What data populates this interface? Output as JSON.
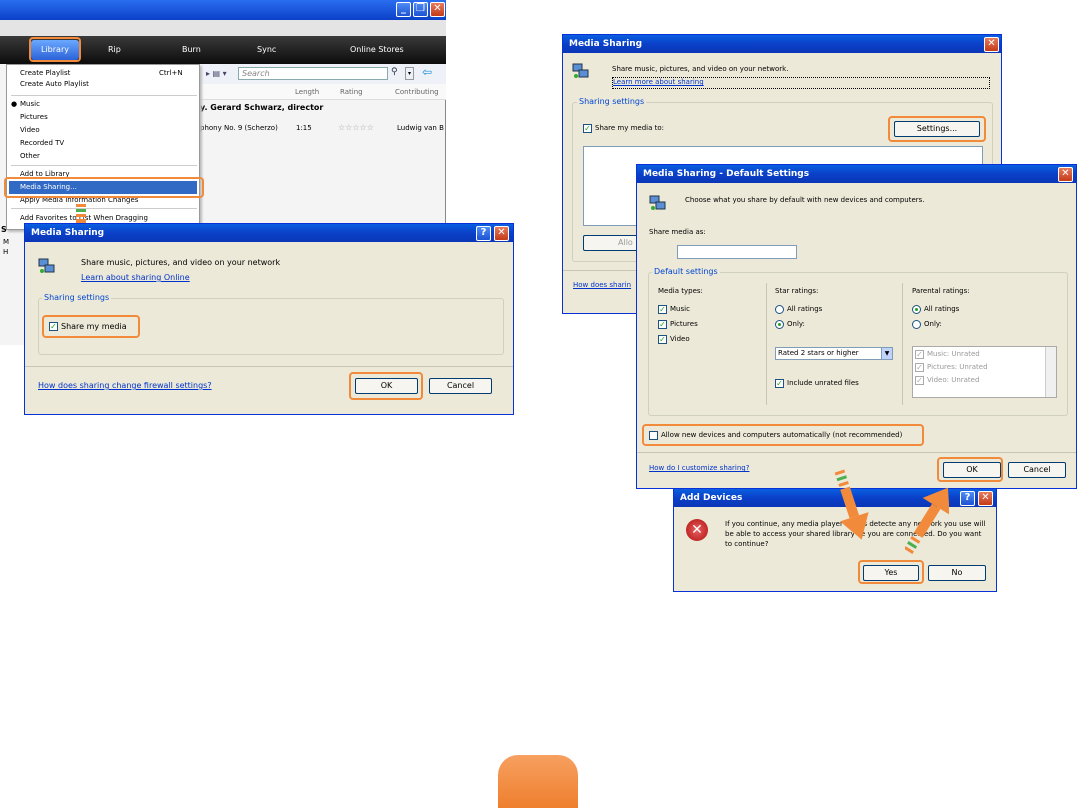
{
  "wmp": {
    "tabs": [
      "Library",
      "Rip",
      "Burn",
      "Sync",
      "Online Stores"
    ],
    "search_placeholder": "Search",
    "columns": [
      "Length",
      "Rating",
      "Contributing"
    ],
    "album_title": "y. Gerard Schwarz, director",
    "track": {
      "title": "phony No. 9 (Scherzo)",
      "length": "1:15",
      "contributing": "Ludwig van B"
    },
    "menu": {
      "create_playlist": "Create Playlist",
      "create_playlist_shortcut": "Ctrl+N",
      "create_auto_playlist": "Create Auto Playlist",
      "categories": [
        "Music",
        "Pictures",
        "Video",
        "Recorded TV",
        "Other"
      ],
      "add_to_library": "Add to Library",
      "media_sharing": "Media Sharing...",
      "apply_media_info": "Apply Media Information Changes",
      "add_favorites": "Add Favorites to List When Dragging"
    },
    "side_s": "S",
    "side_m": "M",
    "side_h": "H"
  },
  "dialog1": {
    "title": "Media Sharing",
    "description": "Share music, pictures, and video on your network",
    "learn_link": "Learn about sharing Online",
    "group_title": "Sharing settings",
    "share_label": "Share my media",
    "firewall_link": "How does sharing change firewall settings?",
    "ok": "OK",
    "cancel": "Cancel"
  },
  "dialog2": {
    "title": "Media Sharing",
    "description": "Share music, pictures, and video on your network.",
    "learn_link": "Learn more about sharing",
    "group_title": "Sharing settings",
    "share_label": "Share my media to:",
    "settings_button": "Settings...",
    "allow_partial": "Allo",
    "how_partial": "How does sharin"
  },
  "dialog3": {
    "title": "Media Sharing - Default Settings",
    "description": "Choose what you share by default with new devices and computers.",
    "share_as_label": "Share media as:",
    "group_title": "Default settings",
    "media_types_label": "Media types:",
    "media_types": [
      "Music",
      "Pictures",
      "Video"
    ],
    "star_label": "Star ratings:",
    "star_all": "All ratings",
    "star_only": "Only:",
    "star_select": "Rated 2 stars or higher",
    "include_unrated": "Include unrated files",
    "parental_label": "Parental ratings:",
    "parental_all": "All ratings",
    "parental_only": "Only:",
    "parental_items": [
      "Music: Unrated",
      "Pictures: Unrated",
      "Video: Unrated"
    ],
    "allow_new": "Allow new devices and computers automatically (not recommended)",
    "customize_link": "How do I customize sharing?",
    "ok": "OK",
    "cancel": "Cancel"
  },
  "dialog4": {
    "title": "Add Devices",
    "message": "If you continue, any media player that is detecte   any network you use will be able to access your shared library   ile you are connected. Do you want to continue?",
    "yes": "Yes",
    "no": "No"
  },
  "colors": {
    "highlight": "#f28a3b",
    "titlebar": "#0a40c8",
    "dialog_bg": "#ece9d8"
  }
}
